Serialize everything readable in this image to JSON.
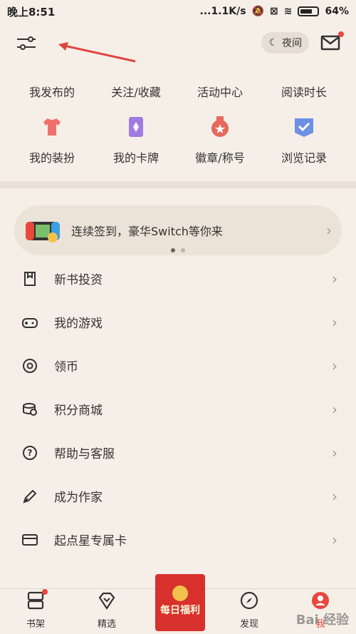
{
  "status_bar": {
    "time": "晚上8:51",
    "network": "...1.1K/s",
    "battery": "64%"
  },
  "top_bar": {
    "night_label": "夜间"
  },
  "quick_grid": {
    "row1": [
      "我发布的",
      "关注/收藏",
      "活动中心",
      "阅读时长"
    ],
    "row2": [
      {
        "label": "我的装扮",
        "icon": "shirt-icon",
        "color": "#f1706a"
      },
      {
        "label": "我的卡牌",
        "icon": "card-icon",
        "color": "#a07be0"
      },
      {
        "label": "徽章/称号",
        "icon": "medal-icon",
        "color": "#e8685e"
      },
      {
        "label": "浏览记录",
        "icon": "history-icon",
        "color": "#6d8fe6"
      }
    ]
  },
  "banner": {
    "text": "连续签到，豪华Switch等你来"
  },
  "menu": [
    {
      "label": "新书投资",
      "icon": "bookmark-icon"
    },
    {
      "label": "我的游戏",
      "icon": "gamepad-icon"
    },
    {
      "label": "领币",
      "icon": "coin-icon"
    },
    {
      "label": "积分商城",
      "icon": "points-icon"
    },
    {
      "label": "帮助与客服",
      "icon": "help-icon"
    },
    {
      "label": "成为作家",
      "icon": "pen-icon"
    },
    {
      "label": "起点星专属卡",
      "icon": "card-icon"
    }
  ],
  "bottom_nav": {
    "bookshelf": "书架",
    "featured": "精选",
    "daily_bonus": "每日福利",
    "discover": "发现",
    "me": "我"
  },
  "watermark": "Bai 经验"
}
